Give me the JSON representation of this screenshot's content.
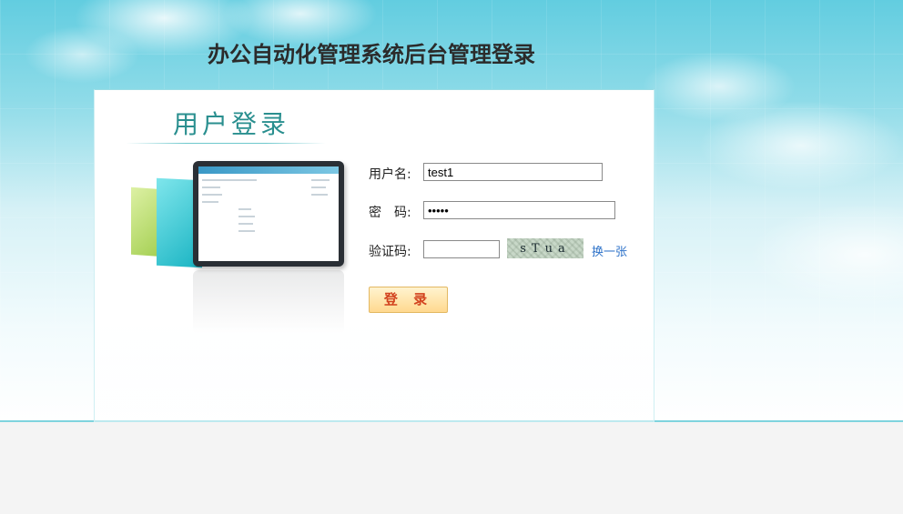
{
  "page": {
    "title": "办公自动化管理系统后台管理登录"
  },
  "panel": {
    "heading": "用户登录"
  },
  "form": {
    "username_label": "用户名:",
    "username_value": "test1",
    "password_label": "密　码:",
    "password_value": "•••••",
    "captcha_label": "验证码:",
    "captcha_value": "",
    "captcha_text": "sTua",
    "refresh_link": "换一张",
    "login_button": "登 录"
  },
  "colors": {
    "sky_top": "#62cde0",
    "heading": "#2a8f8f",
    "link": "#2f73c9",
    "login_text": "#d2421e",
    "login_bg": "#ffd98f"
  }
}
